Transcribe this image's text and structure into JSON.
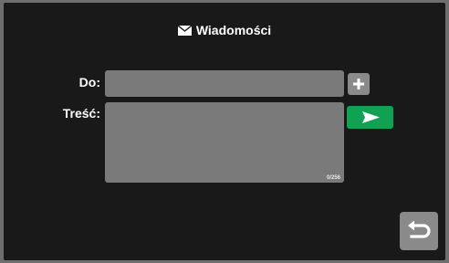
{
  "header": {
    "icon": "envelope-icon",
    "title": "Wiadomości"
  },
  "form": {
    "to_label": "Do:",
    "to_value": "",
    "body_label": "Treść:",
    "body_value": "",
    "char_counter": "0/256"
  },
  "buttons": {
    "add_recipient_icon": "plus-icon",
    "send_icon": "send-arrow-icon",
    "back_icon": "return-arrow-icon"
  },
  "colors": {
    "background": "#191919",
    "field": "#7a7a7a",
    "button_gray": "#8a8a8a",
    "send_green": "#10a152",
    "text": "#ffffff"
  }
}
